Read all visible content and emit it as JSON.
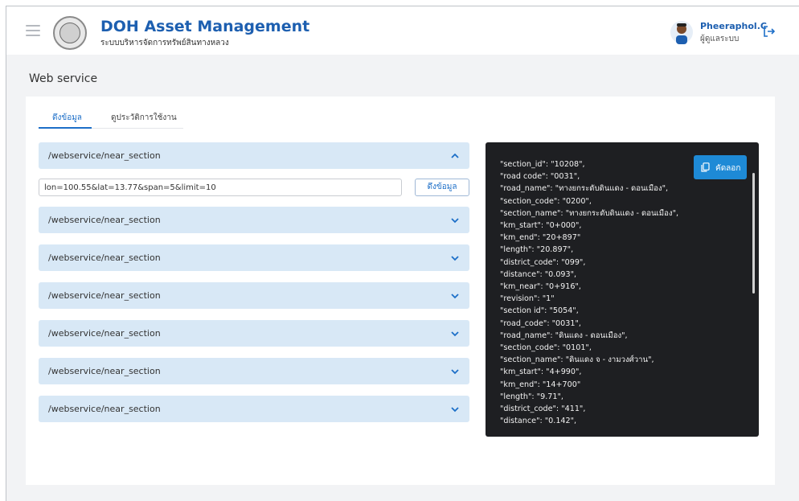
{
  "header": {
    "app_title": "DOH Asset Management",
    "app_subtitle": "ระบบบริหารจัดการทรัพย์สินทางหลวง",
    "user_name": "Pheeraphol.C",
    "user_role": "ผู้ดูแลระบบ"
  },
  "page": {
    "title": "Web service"
  },
  "tabs": [
    {
      "label": "ดึงข้อมูล",
      "active": true
    },
    {
      "label": "ดูประวัติการใช้งาน",
      "active": false
    }
  ],
  "accordion": [
    {
      "label": "/webservice/near_section",
      "expanded": true
    },
    {
      "label": "/webservice/near_section",
      "expanded": false
    },
    {
      "label": "/webservice/near_section",
      "expanded": false
    },
    {
      "label": "/webservice/near_section",
      "expanded": false
    },
    {
      "label": "/webservice/near_section",
      "expanded": false
    },
    {
      "label": "/webservice/near_section",
      "expanded": false
    },
    {
      "label": "/webservice/near_section",
      "expanded": false
    }
  ],
  "query": {
    "value": "lon=100.55&lat=13.77&span=5&limit=10",
    "fetch_label": "ดึงข้อมูล"
  },
  "result": {
    "copy_label": "คัดลอก",
    "json_text": "\"section_id\": \"10208\",\n\"road code\": \"0031\",\n\"road_name\": \"ทางยกระดับดินแดง - ดอนเมือง\",\n\"section_code\": \"0200\",\n\"section_name\": \"ทางยกระดับดินแดง - ดอนเมือง\",\n\"km_start\": \"0+000\",\n\"km_end\": \"20+897\"\n\"length\": \"20.897\",\n\"district_code\": \"099\",\n\"distance\": \"0.093\",\n\"km_near\": \"0+916\",\n\"revision\": \"1\"\n\"section id\": \"5054\",\n\"road_code\": \"0031\",\n\"road_name\": \"ดินแดง - ดอนเมือง\",\n\"section_code\": \"0101\",\n\"section_name\": \"ดินแดง จ - งามวงศ์วาน\",\n\"km_start\": \"4+990\",\n\"km_end\": \"14+700\"\n\"length\": \"9.71\",\n\"district_code\": \"411\",\n\"distance\": \"0.142\","
  },
  "colors": {
    "brand": "#1d5fb0",
    "accordion_bg": "#d8e8f6",
    "console_bg": "#1e1f22",
    "copy_button": "#1e8ad6"
  },
  "icons": {
    "menu": "hamburger-icon",
    "logout": "logout-icon",
    "chevron_up": "chevron-up-icon",
    "chevron_down": "chevron-down-icon",
    "copy": "copy-icon"
  }
}
